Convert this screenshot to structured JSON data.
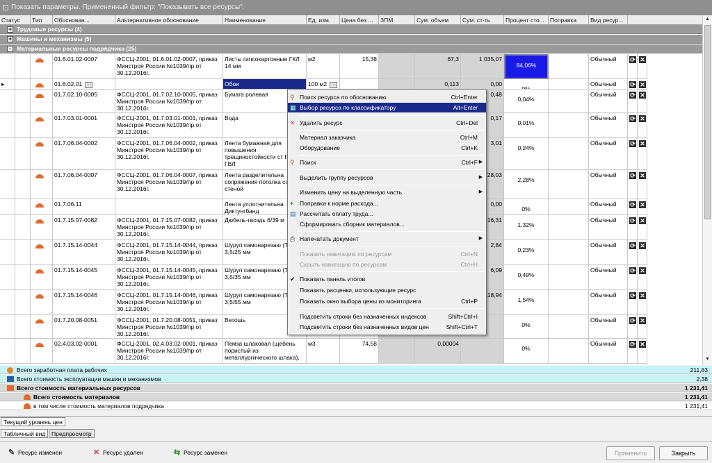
{
  "topbar": {
    "text": "Показать параметры. Примененный фильтр: \"Показывать все ресурсы\".",
    "toggle": "-"
  },
  "columns": [
    "Статус",
    "Тип",
    "Обоснован...",
    "Альтернативное обоснование",
    "Наименование",
    "Ед. изм.",
    "Цена без ...",
    "ЗПМ",
    "Сум. объем",
    "Сум. ст-ть",
    "Процент сто...",
    "Поправка",
    "Вид ресур..."
  ],
  "groups": [
    {
      "toggle": "+",
      "label": "Трудовые ресурсы (4)"
    },
    {
      "toggle": "+",
      "label": "Машины и механизмы (5)"
    },
    {
      "toggle": "-",
      "label": "Материальные ресурсы подрядчика (25)"
    }
  ],
  "rows": [
    {
      "code": "01.6.01.02-0007",
      "alt": "ФССЦ-2001, 01.6.01.02-0007, приказ Минстроя России №1039/пр от 30.12.2016г.",
      "name": "Листы гипсокартонные ГКЛ 14 мм",
      "unit": "м2",
      "price": "15,38",
      "zpm": "",
      "vol": "67,3",
      "cost": "1 035,07",
      "pct": "84,06%",
      "vid": "Обычный"
    },
    {
      "code": "01.6.02.01",
      "alt": "",
      "name": "Обои",
      "unit": "100 м2",
      "price": "",
      "zpm": "",
      "vol": "0,113",
      "cost": "0,00",
      "pct": "0%",
      "vid": "Обычный"
    },
    {
      "code": "01.7.02.10-0005",
      "alt": "ФССЦ-2001, 01.7.02.10-0005, приказ Минстроя России №1039/пр от 30.12.2016г.",
      "name": "Бумага ролевая",
      "unit": "",
      "price": "",
      "zpm": "",
      "vol": "",
      "cost": "0,48",
      "pct": "0,04%",
      "vid": "Обычный"
    },
    {
      "code": "01.7.03.01-0001",
      "alt": "ФССЦ-2001, 01.7.03.01-0001, приказ Минстроя России №1039/пр от 30.12.2016г.",
      "name": "Вода",
      "unit": "",
      "price": "",
      "zpm": "",
      "vol": "",
      "cost": "0,17",
      "pct": "0,01%",
      "vid": "Обычный"
    },
    {
      "code": "01.7.06.04-0002",
      "alt": "ФССЦ-2001, 01.7.06.04-0002, приказ Минстроя России №1039/пр от 30.12.2016г.",
      "name": "Лента бумажная для повышения трещиностойкости ст ГКЛ и ГВЛ",
      "unit": "",
      "price": "",
      "zpm": "",
      "vol": "",
      "cost": "3,01",
      "pct": "0,24%",
      "vid": "Обычный"
    },
    {
      "code": "01.7.06.04-0007",
      "alt": "ФССЦ-2001, 01.7.06.04-0007, приказ Минстроя России №1039/пр от 30.12.2016г.",
      "name": "Лента разделительна сопряжения потолка со стеной",
      "unit": "",
      "price": "",
      "zpm": "",
      "vol": "",
      "cost": "28,03",
      "pct": "2,28%",
      "vid": "Обычный"
    },
    {
      "code": "01.7.06.11",
      "alt": "",
      "name": "Лента уплотнительна Диктунгбанд",
      "unit": "",
      "price": "",
      "zpm": "",
      "vol": "",
      "cost": "0,00",
      "pct": "0%",
      "vid": "Обычный"
    },
    {
      "code": "01.7.15.07-0082",
      "alt": "ФССЦ-2001, 01.7.15.07-0082, приказ Минстроя России №1039/пр от 30.12.2016г.",
      "name": "Дюбель-гвоздь 6/39 м",
      "unit": "",
      "price": "",
      "zpm": "",
      "vol": "",
      "cost": "16,31",
      "pct": "1,32%",
      "vid": "Обычный"
    },
    {
      "code": "01.7.15.14-0044",
      "alt": "ФССЦ-2001, 01.7.15.14-0044, приказ Минстроя России №1039/пр от 30.12.2016г.",
      "name": "Шуруп самонарезаю (TN) 3,5/25 мм",
      "unit": "",
      "price": "",
      "zpm": "",
      "vol": "",
      "cost": "2,84",
      "pct": "0,23%",
      "vid": "Обычный"
    },
    {
      "code": "01.7.15.14-0045",
      "alt": "ФССЦ-2001, 01.7.15.14-0045, приказ Минстроя России №1039/пр от 30.12.2016г.",
      "name": "Шуруп самонарезаю (TN) 3,5/35 мм",
      "unit": "",
      "price": "",
      "zpm": "",
      "vol": "",
      "cost": "6,09",
      "pct": "0,49%",
      "vid": "Обычный"
    },
    {
      "code": "01.7.15.14-0046",
      "alt": "ФССЦ-2001, 01.7.15.14-0046, приказ Минстроя России №1039/пр от 30.12.2016г.",
      "name": "Шуруп самонарезаю (TN) 3,5/55 мм",
      "unit": "",
      "price": "",
      "zpm": "",
      "vol": "",
      "cost": "18,94",
      "pct": "1,54%",
      "vid": "Обычный"
    },
    {
      "code": "01.7.20.08-0051",
      "alt": "ФССЦ-2001, 01.7.20.08-0051, приказ Минстроя России №1039/пр от 30.12.2016г.",
      "name": "Ветошь",
      "unit": "",
      "price": "",
      "zpm": "",
      "vol": "",
      "cost": "",
      "pct": "0%",
      "vid": "Обычный"
    },
    {
      "code": "02.4.03.02-0001",
      "alt": "ФССЦ-2001, 02.4.03.02-0001, приказ Минстроя России №1039/пр от 30.12.2016г.",
      "name": "Пемза шлаковая (щебень пористый из металлургического шлака),",
      "unit": "м3",
      "price": "74,58",
      "zpm": "",
      "vol": "0,00004",
      "cost": "",
      "pct": "0%",
      "vid": "Обычный"
    }
  ],
  "summary": [
    {
      "label": "Всего заработная плата рабочих",
      "value": "211,83"
    },
    {
      "label": "Всего стоимость эксплуатации машин и механизмов",
      "value": "2,38"
    },
    {
      "label": "Всего стоимость материальных ресурсов",
      "value": "1 231,41"
    },
    {
      "label": "Всего стоимость материалов",
      "value": "1 231,41"
    },
    {
      "label": "в том числе стоимость материалов подрядчика",
      "value": "1 231,41"
    }
  ],
  "tabs": {
    "price_level": "Текущий уровень цен",
    "table_view": "Табличный вид",
    "preview": "Предпросмотр"
  },
  "legend": {
    "changed": "Ресурс изменен",
    "deleted": "Ресурс удален",
    "replaced": "Ресурс заменен"
  },
  "buttons": {
    "apply": "Применить",
    "close": "Закрыть"
  },
  "menu": [
    {
      "label": "Поиск ресурса по обоснованию",
      "shortcut": "Ctrl+Enter",
      "icon": "search-icon"
    },
    {
      "label": "Выбор ресурса по классификатору",
      "shortcut": "Alt+Enter",
      "icon": "classifier-icon"
    },
    {
      "label": "Удалить ресурс",
      "shortcut": "Ctrl+Del",
      "icon": "delete-icon"
    },
    {
      "label": "Материал заказчика",
      "shortcut": "Ctrl+M"
    },
    {
      "label": "Оборудование",
      "shortcut": "Ctrl+K"
    },
    {
      "label": "Поиск",
      "shortcut": "Ctrl+F",
      "icon": "search-icon"
    },
    {
      "label": "Выделить группу ресурсов"
    },
    {
      "label": "Изменить цену на выделенную часть"
    },
    {
      "label": "Поправка к норме расхода...",
      "icon": "plus-icon"
    },
    {
      "label": "Рассчитать оплату труда...",
      "icon": "calc-icon"
    },
    {
      "label": "Сформировать сборник материалов..."
    },
    {
      "label": "Напечатать документ",
      "icon": "printer-icon"
    },
    {
      "label": "Показать навигацию по ресурсам",
      "shortcut": "Ctrl+N"
    },
    {
      "label": "Скрыть навигацию по ресурсам",
      "shortcut": "Ctrl+H"
    },
    {
      "label": "Показать панель итогов",
      "icon": "check-icon"
    },
    {
      "label": "Показать расценки, использующие ресурс"
    },
    {
      "label": "Показать окно выбора цены из мониторинга",
      "shortcut": "Ctrl+P"
    },
    {
      "label": "Подсветить строки без назначенных индексов",
      "shortcut": "Shift+Ctrl+I"
    },
    {
      "label": "Подсветить строки без назначенных видов цен",
      "shortcut": "Shift+Ctrl+T"
    }
  ],
  "colors": {
    "group_bg": "#9a9a9a",
    "highlight": "#1a1ae6",
    "menu_selected": "#1b2a8a",
    "summary_cyan": "#c8f4f8",
    "summary_gray": "#d8d8d8"
  }
}
